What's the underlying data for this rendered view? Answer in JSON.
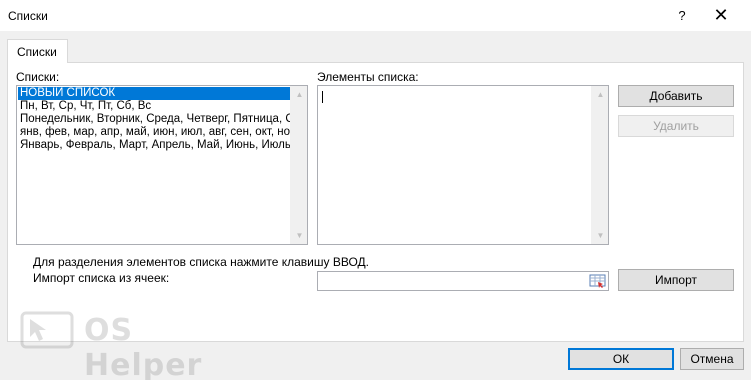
{
  "window": {
    "title": "Списки",
    "help_label": "?",
    "close_label": "✕"
  },
  "tab": {
    "label": "Списки"
  },
  "lists": {
    "label": "Списки:",
    "items": [
      "НОВЫЙ СПИСОК",
      "Пн, Вт, Ср, Чт, Пт, Сб, Вс",
      "Понедельник, Вторник, Среда, Четверг, Пятница, Суббота, Воскресенье",
      "янв, фев, мар, апр, май, июн, июл, авг, сен, окт, ноя, дек",
      "Январь, Февраль, Март, Апрель, Май, Июнь, Июль, Август, Сентябрь, Октябрь, Ноябрь, Декабрь"
    ],
    "selected_index": 0
  },
  "entries": {
    "label": "Элементы списка:",
    "value": ""
  },
  "buttons": {
    "add": "Добавить",
    "delete": "Удалить",
    "import": "Импорт",
    "ok": "ОК",
    "cancel": "Отмена"
  },
  "hint": "Для разделения элементов списка нажмите клавишу ВВОД.",
  "import": {
    "label": "Импорт списка из ячеек:",
    "value": ""
  },
  "watermark": {
    "text": "OS Helper"
  }
}
